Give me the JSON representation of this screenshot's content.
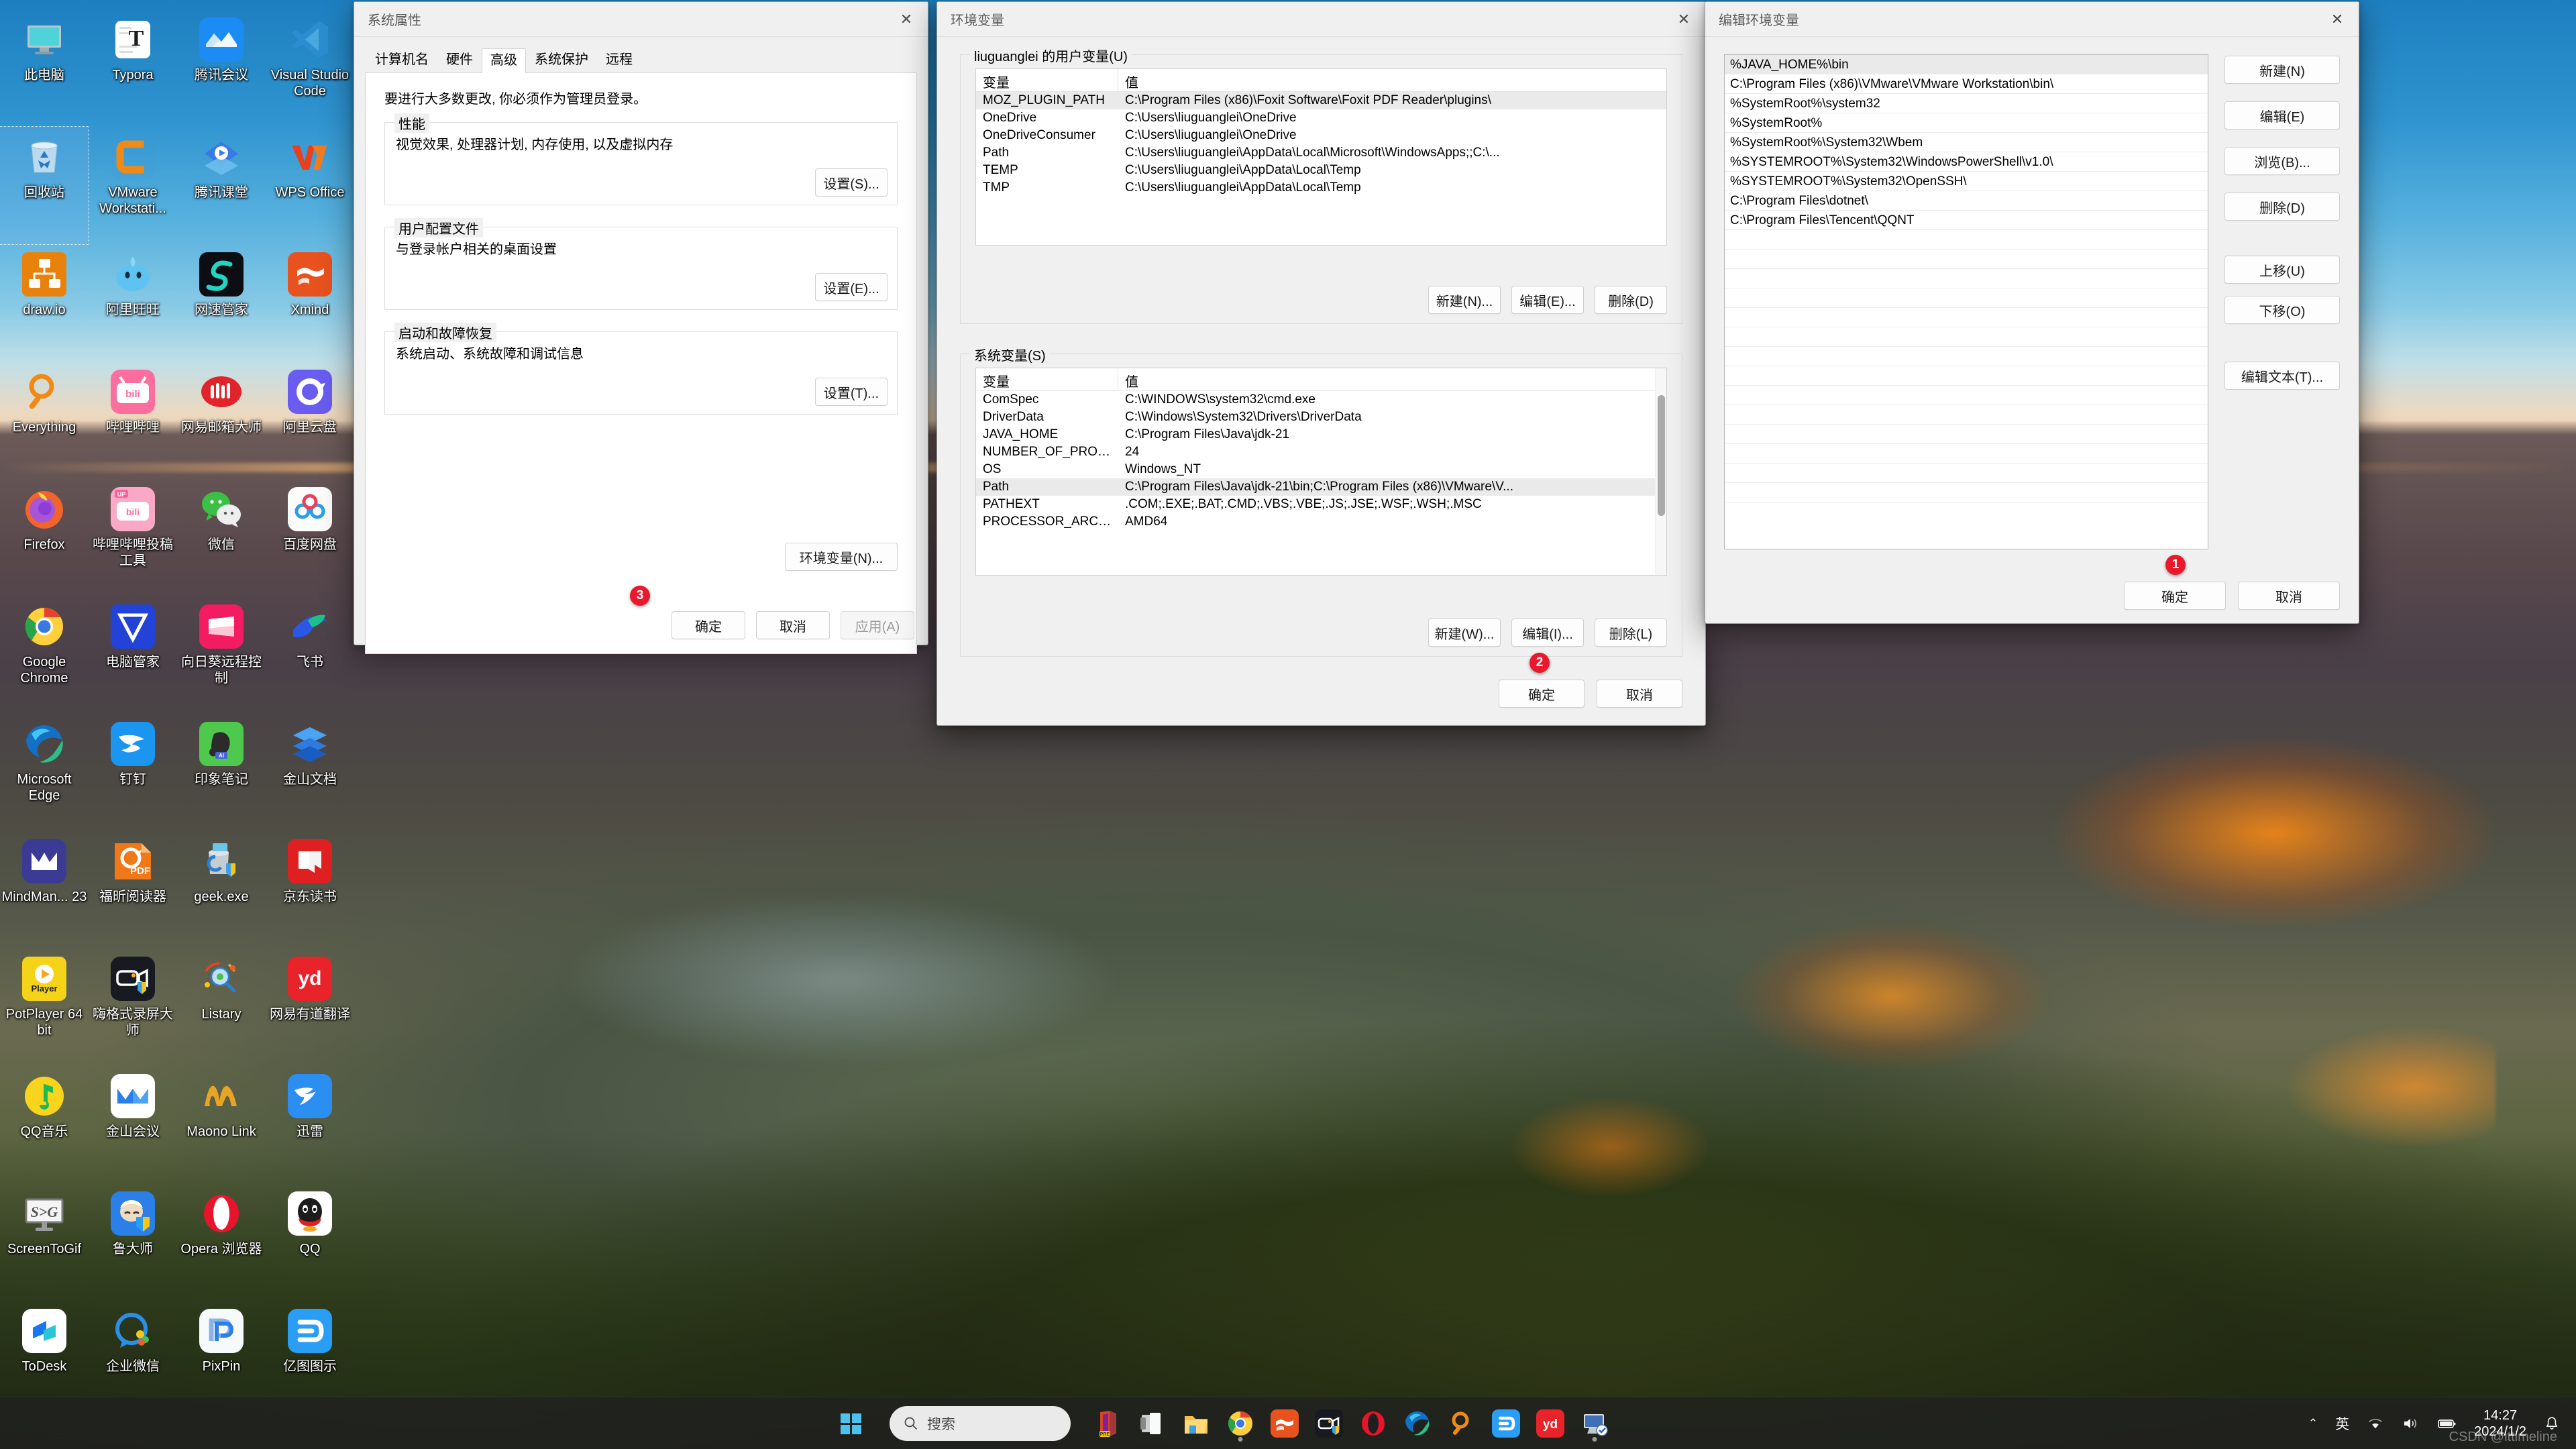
{
  "desktop": {
    "icons": [
      {
        "label": "此电脑",
        "icon": "this-pc-icon",
        "kind": "pc",
        "selected": false
      },
      {
        "label": "Typora",
        "icon": "typora-icon",
        "kind": "typora",
        "selected": false
      },
      {
        "label": "腾讯会议",
        "icon": "tencent-meeting-icon",
        "kind": "tmeeting",
        "selected": false
      },
      {
        "label": "Visual Studio Code",
        "icon": "vscode-icon",
        "kind": "vscode",
        "selected": false
      },
      {
        "label": "回收站",
        "icon": "recycle-bin-icon",
        "kind": "recycle",
        "selected": true
      },
      {
        "label": "VMware Workstati...",
        "icon": "vmware-icon",
        "kind": "vmware",
        "selected": false
      },
      {
        "label": "腾讯课堂",
        "icon": "tencent-class-icon",
        "kind": "tclass",
        "selected": false
      },
      {
        "label": "WPS Office",
        "icon": "wps-office-icon",
        "kind": "wps",
        "selected": false
      },
      {
        "label": "draw.io",
        "icon": "drawio-icon",
        "kind": "drawio",
        "selected": false
      },
      {
        "label": "阿里旺旺",
        "icon": "aliwangwang-icon",
        "kind": "wangwang",
        "selected": false
      },
      {
        "label": "网速管家",
        "icon": "netspeed-icon",
        "kind": "netspeed",
        "selected": false
      },
      {
        "label": "Xmind",
        "icon": "xmind-icon",
        "kind": "xmind",
        "selected": false
      },
      {
        "label": "Everything",
        "icon": "everything-icon",
        "kind": "everything",
        "selected": false
      },
      {
        "label": "哔哩哔哩",
        "icon": "bilibili-icon",
        "kind": "bilibili",
        "selected": false
      },
      {
        "label": "网易邮箱大师",
        "icon": "netease-mail-icon",
        "kind": "neteasemail",
        "selected": false
      },
      {
        "label": "阿里云盘",
        "icon": "aliyun-drive-icon",
        "kind": "aliyunpan",
        "selected": false
      },
      {
        "label": "Firefox",
        "icon": "firefox-icon",
        "kind": "firefox",
        "selected": false
      },
      {
        "label": "哔哩哔哩投稿工具",
        "icon": "bilibili-upload-icon",
        "kind": "biliup",
        "selected": false
      },
      {
        "label": "微信",
        "icon": "wechat-icon",
        "kind": "wechat",
        "selected": false
      },
      {
        "label": "百度网盘",
        "icon": "baidu-netdisk-icon",
        "kind": "baidupan",
        "selected": false
      },
      {
        "label": "Google Chrome",
        "icon": "chrome-icon",
        "kind": "chrome",
        "selected": false
      },
      {
        "label": "电脑管家",
        "icon": "pc-manager-icon",
        "kind": "pcmanager",
        "selected": false
      },
      {
        "label": "向日葵远程控制",
        "icon": "sunlogin-icon",
        "kind": "sunlogin",
        "selected": false
      },
      {
        "label": "飞书",
        "icon": "feishu-icon",
        "kind": "feishu",
        "selected": false
      },
      {
        "label": "Microsoft Edge",
        "icon": "edge-icon",
        "kind": "edge",
        "selected": false
      },
      {
        "label": "钉钉",
        "icon": "dingtalk-icon",
        "kind": "dingtalk",
        "selected": false
      },
      {
        "label": "印象笔记",
        "icon": "evernote-icon",
        "kind": "evernote",
        "selected": false
      },
      {
        "label": "金山文档",
        "icon": "kingsoft-docs-icon",
        "kind": "ksdocs",
        "selected": false
      },
      {
        "label": "MindMan... 23",
        "icon": "mindmanager-icon",
        "kind": "mindmanager",
        "selected": false
      },
      {
        "label": "福昕阅读器",
        "icon": "foxit-reader-icon",
        "kind": "foxit",
        "selected": false
      },
      {
        "label": "geek.exe",
        "icon": "geek-uninstaller-icon",
        "kind": "geek",
        "selected": false
      },
      {
        "label": "京东读书",
        "icon": "jd-read-icon",
        "kind": "jdread",
        "selected": false
      },
      {
        "label": "PotPlayer 64 bit",
        "icon": "potplayer-icon",
        "kind": "potplayer",
        "selected": false
      },
      {
        "label": "嗨格式录屏大师",
        "icon": "higeshi-recorder-icon",
        "kind": "higeshi",
        "selected": false
      },
      {
        "label": "Listary",
        "icon": "listary-icon",
        "kind": "listary",
        "selected": false
      },
      {
        "label": "网易有道翻译",
        "icon": "youdao-icon",
        "kind": "youdao",
        "selected": false
      },
      {
        "label": "QQ音乐",
        "icon": "qq-music-icon",
        "kind": "qqmusic",
        "selected": false
      },
      {
        "label": "金山会议",
        "icon": "kingsoft-meeting-icon",
        "kind": "ksmeeting",
        "selected": false
      },
      {
        "label": "Maono Link",
        "icon": "maono-link-icon",
        "kind": "maono",
        "selected": false
      },
      {
        "label": "迅雷",
        "icon": "thunder-icon",
        "kind": "thunder",
        "selected": false
      },
      {
        "label": "ScreenToGif",
        "icon": "screentogif-icon",
        "kind": "s2g",
        "selected": false
      },
      {
        "label": "鲁大师",
        "icon": "ludashi-icon",
        "kind": "ludashi",
        "selected": false
      },
      {
        "label": "Opera 浏览器",
        "icon": "opera-icon",
        "kind": "opera",
        "selected": false
      },
      {
        "label": "QQ",
        "icon": "qq-icon",
        "kind": "qq",
        "selected": false
      },
      {
        "label": "ToDesk",
        "icon": "todesk-icon",
        "kind": "todesk",
        "selected": false
      },
      {
        "label": "企业微信",
        "icon": "wecom-icon",
        "kind": "wecom",
        "selected": false
      },
      {
        "label": "PixPin",
        "icon": "pixpin-icon",
        "kind": "pixpin",
        "selected": false
      },
      {
        "label": "亿图图示",
        "icon": "edraw-icon",
        "kind": "edraw",
        "selected": false
      }
    ]
  },
  "system_properties": {
    "title": "系统属性",
    "close_label": "✕",
    "tabs": [
      {
        "label": "计算机名",
        "active": false
      },
      {
        "label": "硬件",
        "active": false
      },
      {
        "label": "高级",
        "active": true
      },
      {
        "label": "系统保护",
        "active": false
      },
      {
        "label": "远程",
        "active": false
      }
    ],
    "admin_note": "要进行大多数更改, 你必须作为管理员登录。",
    "groups": [
      {
        "title": "性能",
        "desc": "视觉效果, 处理器计划, 内存使用, 以及虚拟内存",
        "button": "设置(S)..."
      },
      {
        "title": "用户配置文件",
        "desc": "与登录帐户相关的桌面设置",
        "button": "设置(E)..."
      },
      {
        "title": "启动和故障恢复",
        "desc": "系统启动、系统故障和调试信息",
        "button": "设置(T)..."
      }
    ],
    "env_button": "环境变量(N)...",
    "footer": {
      "ok": "确定",
      "cancel": "取消",
      "apply": "应用(A)"
    },
    "badge": "3"
  },
  "env_variables": {
    "title": "环境变量",
    "close_label": "✕",
    "user_section": {
      "title": "liuguanglei 的用户变量(U)",
      "columns": [
        "变量",
        "值"
      ],
      "rows": [
        {
          "name": "MOZ_PLUGIN_PATH",
          "value": "C:\\Program Files (x86)\\Foxit Software\\Foxit PDF Reader\\plugins\\",
          "selected": true
        },
        {
          "name": "OneDrive",
          "value": "C:\\Users\\liuguanglei\\OneDrive",
          "selected": false
        },
        {
          "name": "OneDriveConsumer",
          "value": "C:\\Users\\liuguanglei\\OneDrive",
          "selected": false
        },
        {
          "name": "Path",
          "value": "C:\\Users\\liuguanglei\\AppData\\Local\\Microsoft\\WindowsApps;;C:\\...",
          "selected": false
        },
        {
          "name": "TEMP",
          "value": "C:\\Users\\liuguanglei\\AppData\\Local\\Temp",
          "selected": false
        },
        {
          "name": "TMP",
          "value": "C:\\Users\\liuguanglei\\AppData\\Local\\Temp",
          "selected": false
        }
      ],
      "buttons": {
        "new": "新建(N)...",
        "edit": "编辑(E)...",
        "delete": "删除(D)"
      }
    },
    "system_section": {
      "title": "系统变量(S)",
      "columns": [
        "变量",
        "值"
      ],
      "rows": [
        {
          "name": "ComSpec",
          "value": "C:\\WINDOWS\\system32\\cmd.exe",
          "selected": false
        },
        {
          "name": "DriverData",
          "value": "C:\\Windows\\System32\\Drivers\\DriverData",
          "selected": false
        },
        {
          "name": "JAVA_HOME",
          "value": "C:\\Program Files\\Java\\jdk-21",
          "selected": false
        },
        {
          "name": "NUMBER_OF_PROCESSORS",
          "value": "24",
          "selected": false
        },
        {
          "name": "OS",
          "value": "Windows_NT",
          "selected": false
        },
        {
          "name": "Path",
          "value": "C:\\Program Files\\Java\\jdk-21\\bin;C:\\Program Files (x86)\\VMware\\V...",
          "selected": true
        },
        {
          "name": "PATHEXT",
          "value": ".COM;.EXE;.BAT;.CMD;.VBS;.VBE;.JS;.JSE;.WSF;.WSH;.MSC",
          "selected": false
        },
        {
          "name": "PROCESSOR_ARCHITECTURE",
          "value": "AMD64",
          "selected": false
        }
      ],
      "buttons": {
        "new": "新建(W)...",
        "edit": "编辑(I)...",
        "delete": "删除(L)"
      }
    },
    "footer": {
      "ok": "确定",
      "cancel": "取消"
    },
    "badge": "2"
  },
  "edit_env_variable": {
    "title": "编辑环境变量",
    "close_label": "✕",
    "entries": [
      {
        "value": "%JAVA_HOME%\\bin",
        "selected": true
      },
      {
        "value": "C:\\Program Files (x86)\\VMware\\VMware Workstation\\bin\\",
        "selected": false
      },
      {
        "value": "%SystemRoot%\\system32",
        "selected": false
      },
      {
        "value": "%SystemRoot%",
        "selected": false
      },
      {
        "value": "%SystemRoot%\\System32\\Wbem",
        "selected": false
      },
      {
        "value": "%SYSTEMROOT%\\System32\\WindowsPowerShell\\v1.0\\",
        "selected": false
      },
      {
        "value": "%SYSTEMROOT%\\System32\\OpenSSH\\",
        "selected": false
      },
      {
        "value": "C:\\Program Files\\dotnet\\",
        "selected": false
      },
      {
        "value": "C:\\Program Files\\Tencent\\QQNT",
        "selected": false
      }
    ],
    "empty_rows": 14,
    "buttons": {
      "new": "新建(N)",
      "edit": "编辑(E)",
      "browse": "浏览(B)...",
      "delete": "删除(D)",
      "move_up": "上移(U)",
      "move_down": "下移(O)",
      "edit_text": "编辑文本(T)..."
    },
    "footer": {
      "ok": "确定",
      "cancel": "取消"
    },
    "badge": "1"
  },
  "taskbar": {
    "start_label": "start-button",
    "search_placeholder": "搜索",
    "items": [
      {
        "name": "office-pre",
        "kind": "office"
      },
      {
        "name": "task-view",
        "kind": "taskview"
      },
      {
        "name": "file-explorer",
        "kind": "explorer"
      },
      {
        "name": "google-chrome",
        "kind": "chrome",
        "active": true
      },
      {
        "name": "xmind",
        "kind": "xmind"
      },
      {
        "name": "screen-recorder",
        "kind": "recorder"
      },
      {
        "name": "opera",
        "kind": "opera"
      },
      {
        "name": "microsoft-edge",
        "kind": "edge"
      },
      {
        "name": "everything",
        "kind": "everything"
      },
      {
        "name": "edraw",
        "kind": "edraw"
      },
      {
        "name": "youdao",
        "kind": "youdao"
      },
      {
        "name": "system-properties",
        "kind": "sysprops",
        "active": true
      }
    ],
    "tray": {
      "chevron": "⌃",
      "ime": "英",
      "wifi": "wifi-icon",
      "volume": "volume-icon",
      "battery": "battery-icon",
      "time": "14:27",
      "date": "2024/1/2",
      "notification": "bell-icon"
    },
    "watermark": "CSDN @ittimeline"
  }
}
